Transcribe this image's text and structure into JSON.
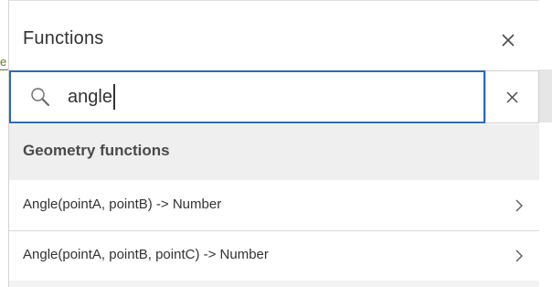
{
  "underlay": {
    "peek_char": "e"
  },
  "panel": {
    "title": "Functions",
    "close_icon": "close-icon"
  },
  "search": {
    "value": "angle",
    "search_icon": "search-icon",
    "clear_icon": "clear-icon"
  },
  "group": {
    "label": "Geometry functions"
  },
  "functions": [
    {
      "label": "Angle(pointA, pointB) -> Number",
      "icon": "chevron-right-icon"
    },
    {
      "label": "Angle(pointA, pointB, pointC) -> Number",
      "icon": "chevron-right-icon"
    }
  ],
  "colors": {
    "focus_border": "#2a6bb5",
    "group_bg": "#efefef",
    "text": "#323232"
  }
}
